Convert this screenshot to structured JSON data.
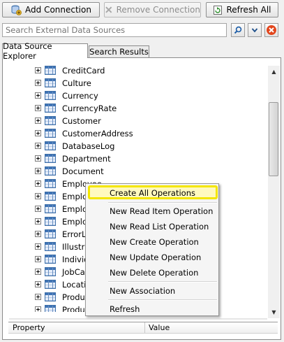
{
  "toolbar": {
    "add_connection_label": "Add Connection",
    "remove_connection_label": "Remove Connection",
    "refresh_all_label": "Refresh All"
  },
  "search": {
    "placeholder": "Search External Data Sources"
  },
  "tabs": [
    {
      "label": "Data Source Explorer",
      "active": true
    },
    {
      "label": "Search Results",
      "active": false
    }
  ],
  "tree": {
    "items": [
      "CreditCard",
      "Culture",
      "Currency",
      "CurrencyRate",
      "Customer",
      "CustomerAddress",
      "DatabaseLog",
      "Department",
      "Document",
      "Employee",
      "Employ",
      "Employ",
      "Employ",
      "ErrorLo",
      "Illustra",
      "Individ",
      "JobCan",
      "Locatio",
      "Produc",
      "Produc"
    ]
  },
  "context_menu": {
    "items": [
      "Create All Operations",
      "New Read Item Operation",
      "New Read List Operation",
      "New Create Operation",
      "New Update Operation",
      "New Delete Operation",
      "New Association",
      "Refresh"
    ]
  },
  "properties": {
    "col_property": "Property",
    "col_value": "Value"
  },
  "colors": {
    "highlight_border": "#f4e600",
    "highlight_fill": "#fff9bf",
    "remove_red": "#e2461d"
  }
}
